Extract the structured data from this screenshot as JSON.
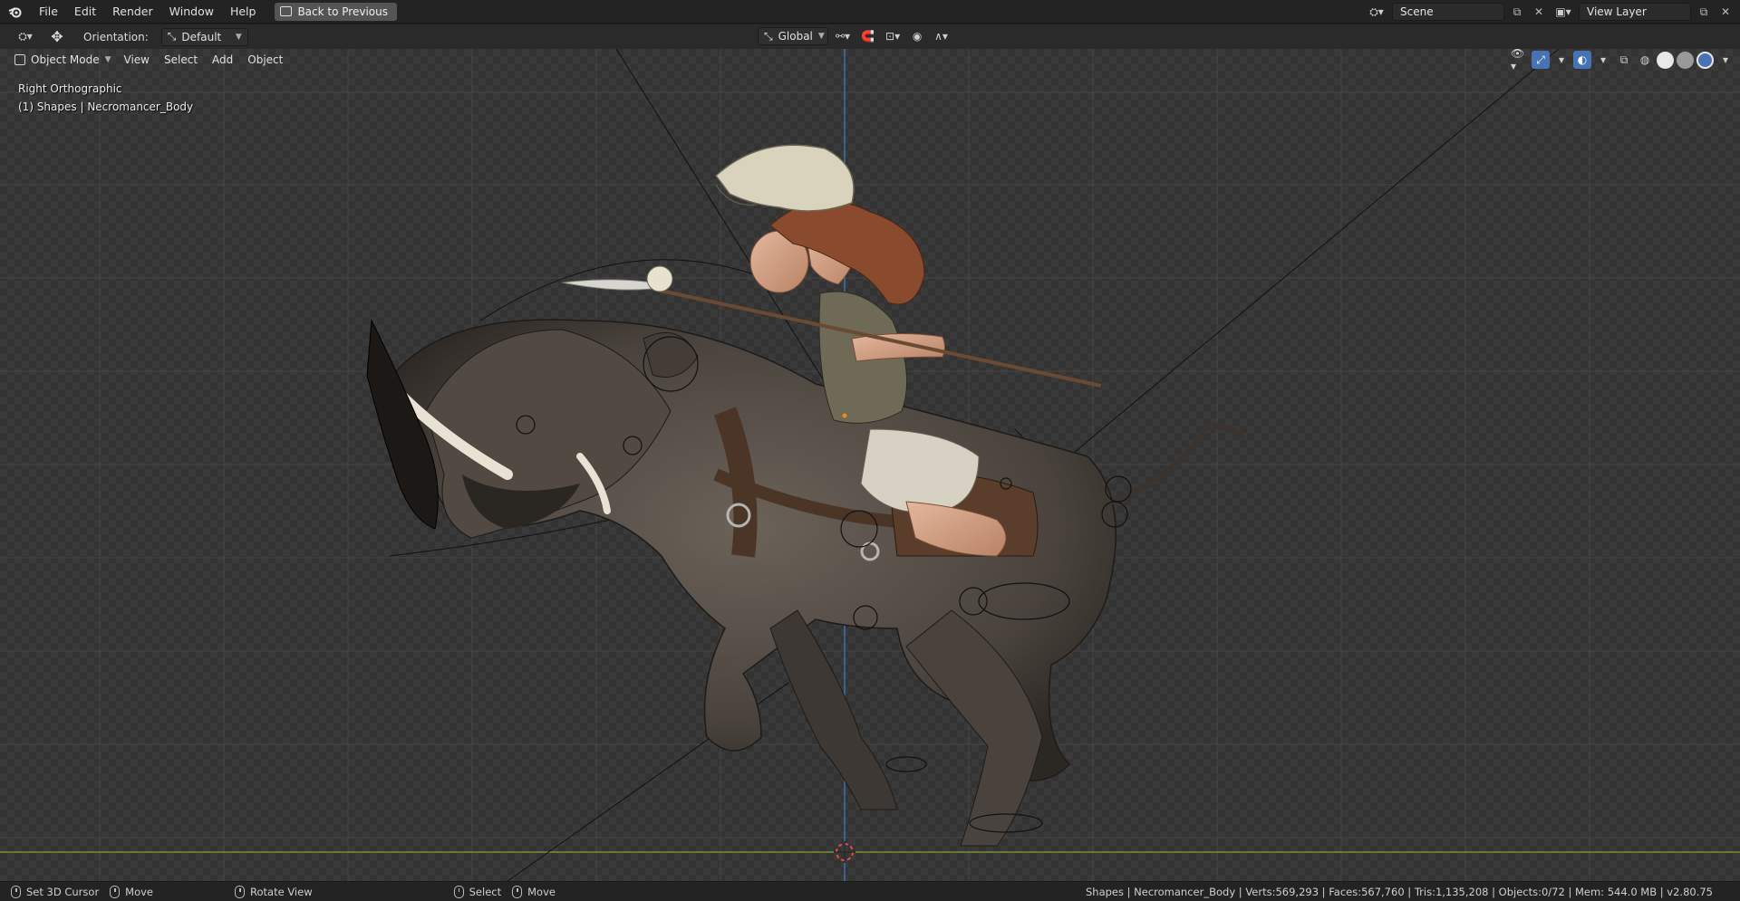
{
  "topbar": {
    "menus": [
      "File",
      "Edit",
      "Render",
      "Window",
      "Help"
    ],
    "back_label": "Back to Previous",
    "scene_name": "Scene",
    "view_layer": "View Layer"
  },
  "toolheader": {
    "orientation_label": "Orientation:",
    "orientation_value": "Default",
    "transform_space": "Global"
  },
  "viewport_header": {
    "mode": "Object Mode",
    "menus": [
      "View",
      "Select",
      "Add",
      "Object"
    ]
  },
  "viewport": {
    "view_name": "Right Orthographic",
    "object_info": "(1) Shapes | Necromancer_Body"
  },
  "statusbar": {
    "set_cursor": "Set 3D Cursor",
    "move1": "Move",
    "rotate": "Rotate View",
    "select": "Select",
    "move2": "Move",
    "stats": "Shapes | Necromancer_Body | Verts:569,293 | Faces:567,760 | Tris:1,135,208 | Objects:0/72 | Mem: 544.0 MB | v2.80.75"
  },
  "colors": {
    "accent": "#4772b3",
    "y_axis": "#3c6fb0",
    "x_axis": "#7fa235",
    "header_bg": "#232323"
  },
  "icons": [
    "blender-logo-icon",
    "back-to-previous-icon",
    "scene-icon",
    "view-layer-icon",
    "move-tool-icon",
    "orientation-icon",
    "global-icon",
    "snap-icon",
    "proportional-edit-icon",
    "visibility-icon",
    "gizmo-icon",
    "overlay-icon",
    "xray-icon",
    "wireframe-shading-icon",
    "solid-shading-icon",
    "material-shading-icon",
    "rendered-shading-icon",
    "mouse-icon",
    "3d-cursor-icon"
  ]
}
